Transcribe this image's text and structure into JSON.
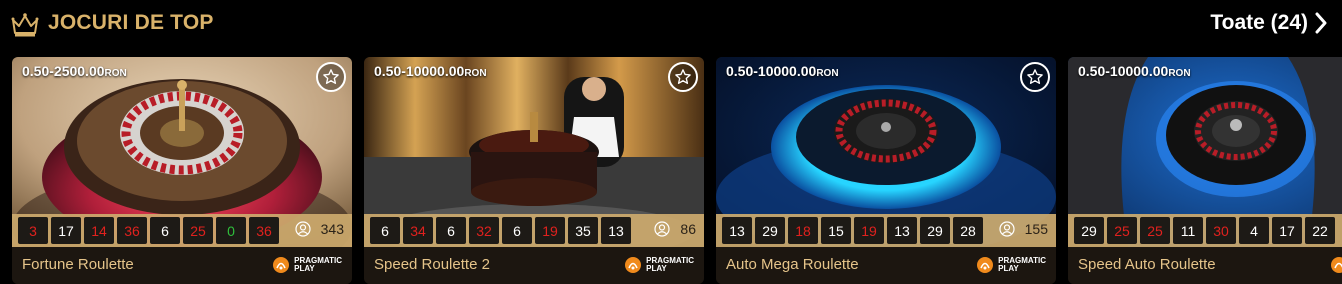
{
  "header": {
    "title": "JOCURI DE TOP",
    "see_all": "Toate (24)"
  },
  "colors": {
    "accent": "#d9b26a",
    "red_number": "#e0211e",
    "green_number": "#2fbf3c",
    "result_bar": "#cdaa6e"
  },
  "games": [
    {
      "limits": "0.50-2500.00",
      "currency": "RON",
      "results": [
        {
          "n": "3",
          "c": "red"
        },
        {
          "n": "17",
          "c": "black"
        },
        {
          "n": "14",
          "c": "red"
        },
        {
          "n": "36",
          "c": "red"
        },
        {
          "n": "6",
          "c": "black"
        },
        {
          "n": "25",
          "c": "red"
        },
        {
          "n": "0",
          "c": "green"
        },
        {
          "n": "36",
          "c": "red"
        }
      ],
      "players": "343",
      "name": "Fortune Roulette",
      "provider_line1": "PRAGMATIC",
      "provider_line2": "PLAY",
      "favorite_icon": "star-icon"
    },
    {
      "limits": "0.50-10000.00",
      "currency": "RON",
      "results": [
        {
          "n": "6",
          "c": "black"
        },
        {
          "n": "34",
          "c": "red"
        },
        {
          "n": "6",
          "c": "black"
        },
        {
          "n": "32",
          "c": "red"
        },
        {
          "n": "6",
          "c": "black"
        },
        {
          "n": "19",
          "c": "red"
        },
        {
          "n": "35",
          "c": "black"
        },
        {
          "n": "13",
          "c": "black"
        }
      ],
      "players": "86",
      "name": "Speed Roulette 2",
      "provider_line1": "PRAGMATIC",
      "provider_line2": "PLAY",
      "favorite_icon": "star-icon"
    },
    {
      "limits": "0.50-10000.00",
      "currency": "RON",
      "results": [
        {
          "n": "13",
          "c": "black"
        },
        {
          "n": "29",
          "c": "black"
        },
        {
          "n": "18",
          "c": "red"
        },
        {
          "n": "15",
          "c": "black"
        },
        {
          "n": "19",
          "c": "red"
        },
        {
          "n": "13",
          "c": "black"
        },
        {
          "n": "29",
          "c": "black"
        },
        {
          "n": "28",
          "c": "black"
        }
      ],
      "players": "155",
      "name": "Auto Mega Roulette",
      "provider_line1": "PRAGMATIC",
      "provider_line2": "PLAY",
      "favorite_icon": "star-icon"
    },
    {
      "limits": "0.50-10000.00",
      "currency": "RON",
      "results": [
        {
          "n": "29",
          "c": "black"
        },
        {
          "n": "25",
          "c": "red"
        },
        {
          "n": "25",
          "c": "red"
        },
        {
          "n": "11",
          "c": "black"
        },
        {
          "n": "30",
          "c": "red"
        },
        {
          "n": "4",
          "c": "black"
        },
        {
          "n": "17",
          "c": "black"
        },
        {
          "n": "22",
          "c": "black"
        }
      ],
      "players": "",
      "name": "Speed Auto Roulette",
      "provider_line1": "",
      "provider_line2": "",
      "favorite_icon": "star-icon"
    }
  ]
}
